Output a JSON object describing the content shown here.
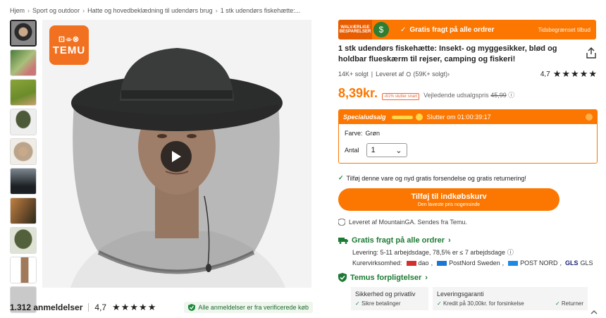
{
  "breadcrumb": {
    "items": [
      "Hjem",
      "Sport og outdoor",
      "Hatte og hovedbeklædning til udendørs brug",
      "1 stk udendørs fiskehætte:..."
    ],
    "separator": "›"
  },
  "gallery": {
    "logo_glyphs": "⊡⌯⊗",
    "logo_word": "TEMU",
    "thumbnail_colors": [
      "#2a2a2a",
      "#4b7a3a",
      "#6b8c2a",
      "#4d5a3a",
      "#bba58a",
      "#1c2024",
      "#6a4a2a",
      "#52613c",
      "#a07a5a",
      "#c9c9c9"
    ]
  },
  "reviews": {
    "count": "1.312 anmeldelser",
    "rating": "4,7",
    "stars": "★★★★★",
    "verified_text": "Alle anmeldelser er fra verificerede køb"
  },
  "promo": {
    "tag": "WALVÆRLIGE BESPARELSER",
    "check": "✓",
    "text": "Gratis fragt på alle ordrer",
    "limited": "Tidsbegrænset tilbud"
  },
  "product": {
    "title": "1 stk udendørs fiskehætte: Insekt- og myggesikker, blød og holdbar flueskærm til rejser, camping og fiskeri!",
    "sold": "14K+ solgt",
    "delivered_by": "Leveret af",
    "seller_sold": "(59K+ solgt)",
    "rating": "4,7",
    "stars": "★★★★★",
    "price": "8,39kr.",
    "discount_chip": "-81% slutter snart",
    "rrp_label": "Vejledende udsalgspris",
    "rrp_value": "45,99"
  },
  "sale": {
    "label": "Specialudsalg",
    "timer": "Slutter om 01:00:39:17",
    "color_label": "Farve:",
    "color_value": "Grøn",
    "qty_label": "Antal",
    "qty_value": "1",
    "qty_chevron": "⌄"
  },
  "cart": {
    "note": "Tilføj denne vare og nyd gratis forsendelse og gratis returnering!",
    "button": "Tilføj til indkøbskurv",
    "button_sub": "Den laveste pris nogensinde",
    "seller_note": "Leveret af MountainGA. Sendes fra Temu."
  },
  "shipping": {
    "title": "Gratis fragt på alle ordrer",
    "delivery": "Levering: 5-11 arbejdsdage, 78,5% er ≤ 7 arbejdsdage",
    "carriers_label": "Kurervirksomhed:",
    "carriers": [
      "dao",
      "PostNord Sweden",
      "POST NORD",
      "GLS"
    ],
    "carrier_colors": [
      "#d32f2f",
      "#1976d2",
      "#1e88e5",
      "#1a237e"
    ]
  },
  "guarantee": {
    "title": "Temus forpligtelser",
    "cards": [
      {
        "title": "Sikkerhed og privatliv",
        "item": "Sikre betalinger"
      },
      {
        "title": "Leveringsgaranti",
        "item": "Kredit på 30,00kr. for forsinkelse",
        "item2": "Returner"
      }
    ]
  }
}
